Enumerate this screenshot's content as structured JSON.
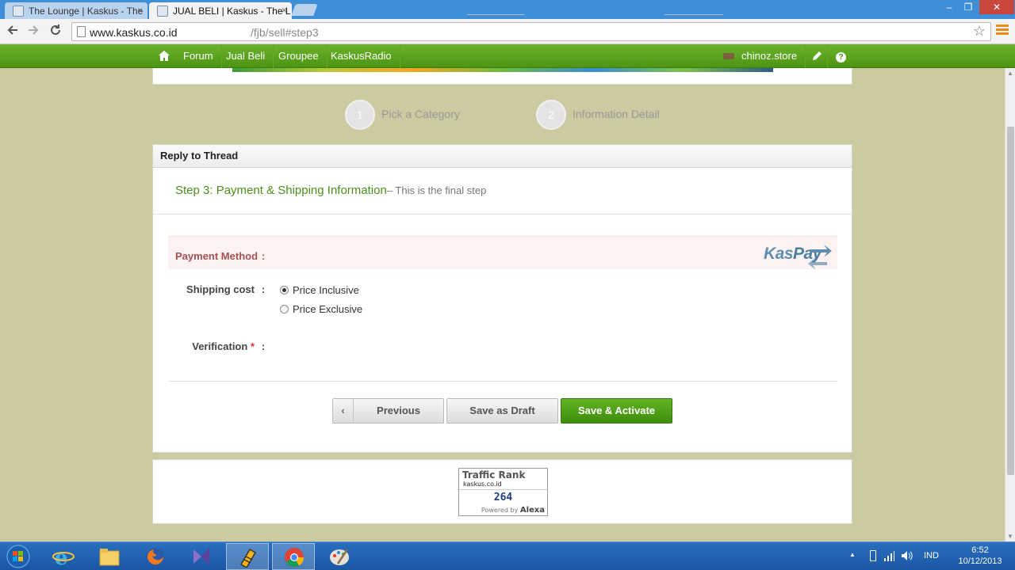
{
  "browser": {
    "tabs": [
      {
        "title": "The Lounge | Kaskus - The",
        "active": false
      },
      {
        "title": "JUAL BELI | Kaskus - The L",
        "active": true
      }
    ],
    "close_glyph": "×",
    "window_controls": {
      "minimize": "‒",
      "maximize": "❐",
      "close": "✕"
    },
    "url_host": "www.kaskus.co.id",
    "url_path": "/fjb/sell#step3"
  },
  "sitenav": {
    "items": [
      "Forum",
      "Jual Beli",
      "Groupee",
      "KaskusRadio"
    ],
    "username": "chinoz.store",
    "help_glyph": "?"
  },
  "steps": [
    {
      "number": "1",
      "label": "Pick a Category"
    },
    {
      "number": "2",
      "label": "Information Detail"
    }
  ],
  "panel": {
    "header": "Reply to Thread",
    "step_title": "Step 3: Payment & Shipping Information",
    "step_subtitle": "– This is the final step",
    "payment_label": "Payment Method",
    "colon": ":",
    "kaspay_kas": "Kas",
    "kaspay_pay": "Pay",
    "shipping_label": "Shipping cost",
    "shipping_options": [
      {
        "label": "Price Inclusive",
        "checked": true
      },
      {
        "label": "Price Exclusive",
        "checked": false
      }
    ],
    "verification_label": "Verification",
    "required_mark": "*",
    "buttons": {
      "previous": "Previous",
      "previous_icon": "‹",
      "draft": "Save as Draft",
      "activate": "Save & Activate"
    }
  },
  "alexa": {
    "title": "Traffic Rank",
    "domain": "kaskus.co.id",
    "rank": "264",
    "powered_by": "Powered by",
    "brand": "Alexa"
  },
  "taskbar": {
    "language": "IND",
    "time": "6:52",
    "date": "10/12/2013",
    "tray_arrow": "▲"
  },
  "colors": {
    "site_green": "#4e9414",
    "page_bg": "#cbcaa0",
    "payment_text": "#a45151",
    "step_title": "#4b8f1d"
  }
}
